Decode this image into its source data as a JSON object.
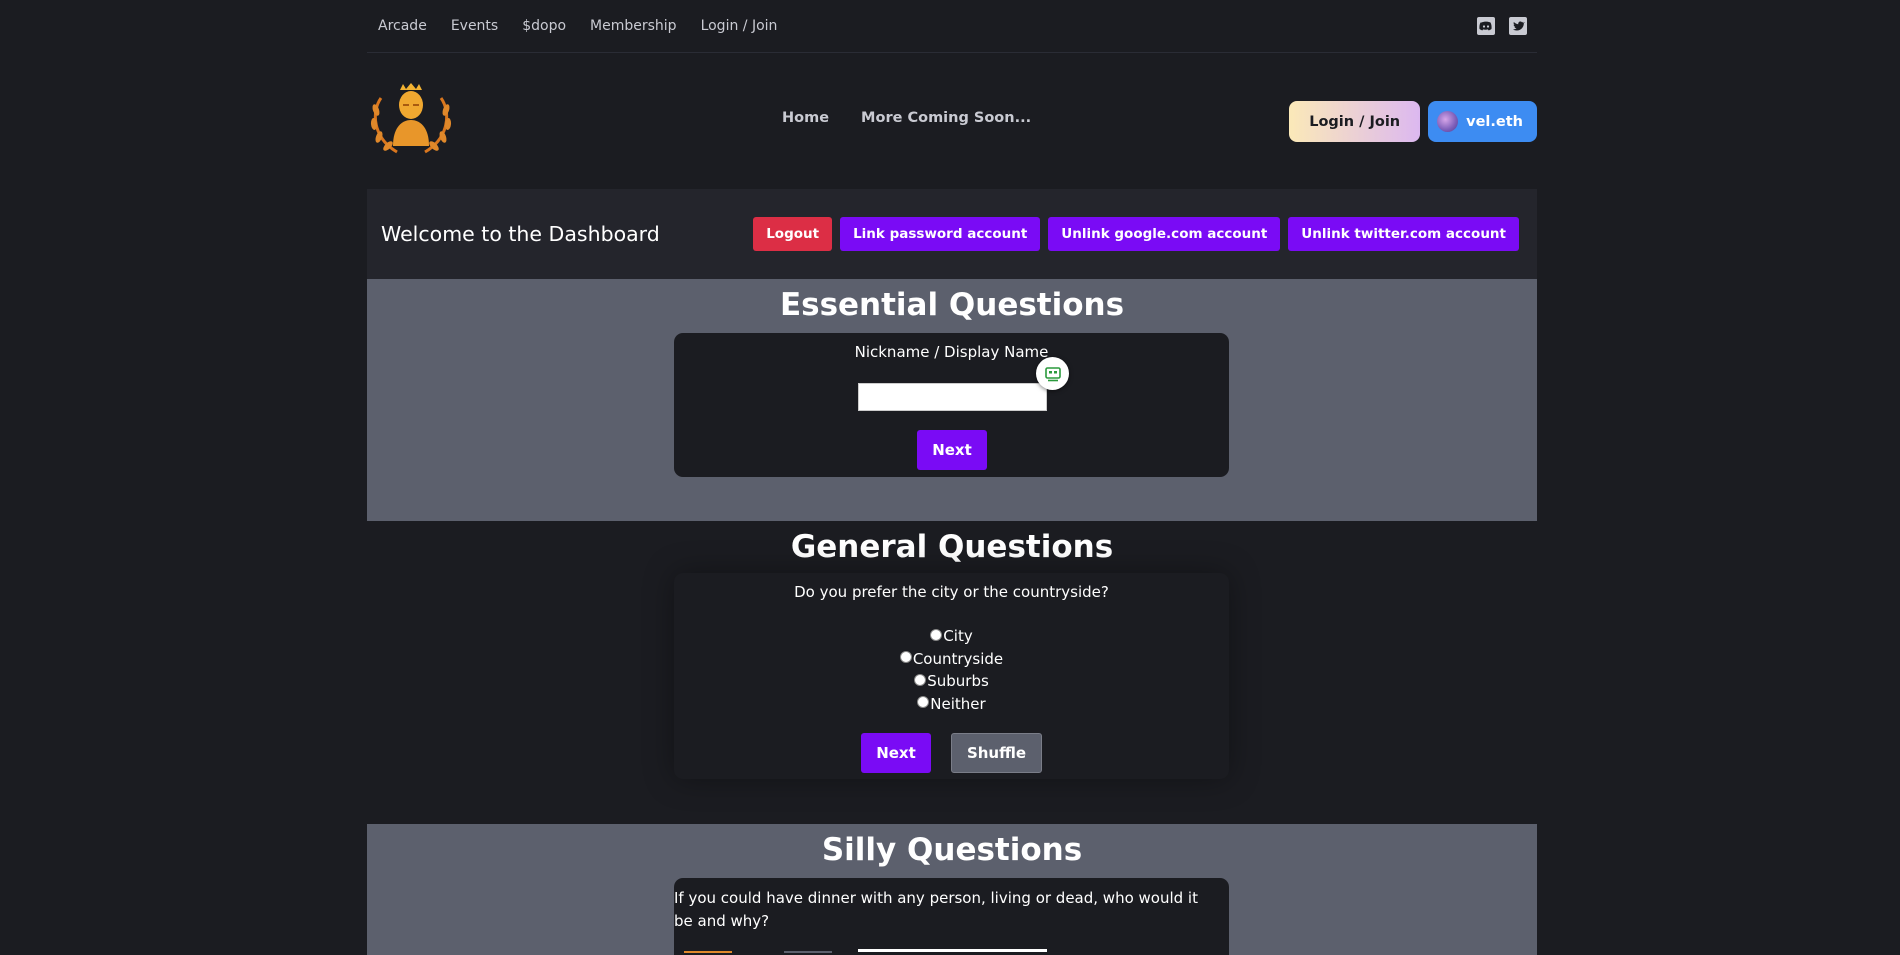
{
  "topnav": {
    "items": [
      "Arcade",
      "Events",
      "$dopo",
      "Membership",
      "Login / Join"
    ],
    "social": [
      "discord-icon",
      "twitter-icon"
    ]
  },
  "header": {
    "nav": [
      "Home",
      "More Coming Soon..."
    ],
    "login_label": "Login / Join",
    "wallet_label": "vel.eth"
  },
  "dashboard": {
    "title": "Welcome to the Dashboard",
    "buttons": {
      "logout": "Logout",
      "link_password": "Link password account",
      "unlink_google": "Unlink google.com account",
      "unlink_twitter": "Unlink twitter.com account"
    }
  },
  "essential": {
    "title": "Essential Questions",
    "label": "Nickname / Display Name",
    "value": "",
    "next_label": "Next"
  },
  "general": {
    "title": "General Questions",
    "question": "Do you prefer the city or the countryside?",
    "options": [
      "City",
      "Countryside",
      "Suburbs",
      "Neither"
    ],
    "next_label": "Next",
    "shuffle_label": "Shuffle"
  },
  "silly": {
    "title": "Silly Questions",
    "question": "If you could have dinner with any person, living or dead, who would it be and why?"
  },
  "colors": {
    "background": "#1b1c21",
    "section_gray": "#5c606d",
    "purple": "#7a0bf5",
    "red": "#dc2e45",
    "wallet_blue": "#3d8cf2"
  }
}
